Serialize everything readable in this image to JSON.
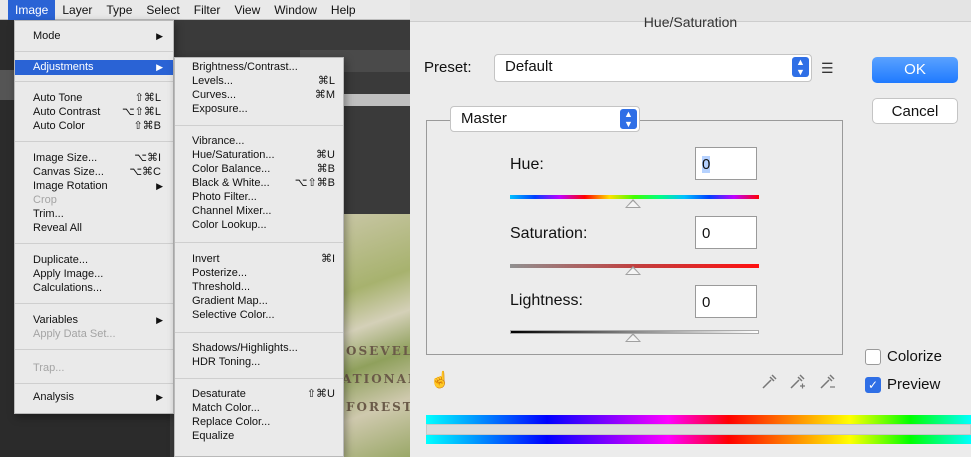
{
  "menubar": {
    "items": [
      "Image",
      "Layer",
      "Type",
      "Select",
      "Filter",
      "View",
      "Window",
      "Help"
    ],
    "active": "Image"
  },
  "image_menu": {
    "items": [
      {
        "label": "Mode",
        "submenu": true
      },
      {
        "label": "Adjustments",
        "submenu": true,
        "highlighted": true
      },
      {
        "label": "Auto Tone",
        "shortcut": "⇧⌘L"
      },
      {
        "label": "Auto Contrast",
        "shortcut": "⌥⇧⌘L"
      },
      {
        "label": "Auto Color",
        "shortcut": "⇧⌘B"
      },
      {
        "label": "Image Size...",
        "shortcut": "⌥⌘I"
      },
      {
        "label": "Canvas Size...",
        "shortcut": "⌥⌘C"
      },
      {
        "label": "Image Rotation",
        "submenu": true
      },
      {
        "label": "Crop",
        "disabled": true
      },
      {
        "label": "Trim..."
      },
      {
        "label": "Reveal All"
      },
      {
        "label": "Duplicate..."
      },
      {
        "label": "Apply Image..."
      },
      {
        "label": "Calculations..."
      },
      {
        "label": "Variables",
        "submenu": true
      },
      {
        "label": "Apply Data Set...",
        "disabled": true
      },
      {
        "label": "Trap...",
        "disabled": true
      },
      {
        "label": "Analysis",
        "submenu": true
      }
    ]
  },
  "adjustments_menu": {
    "items": [
      {
        "label": "Brightness/Contrast..."
      },
      {
        "label": "Levels...",
        "shortcut": "⌘L"
      },
      {
        "label": "Curves...",
        "shortcut": "⌘M"
      },
      {
        "label": "Exposure..."
      },
      {
        "label": "Vibrance..."
      },
      {
        "label": "Hue/Saturation...",
        "shortcut": "⌘U"
      },
      {
        "label": "Color Balance...",
        "shortcut": "⌘B"
      },
      {
        "label": "Black & White...",
        "shortcut": "⌥⇧⌘B"
      },
      {
        "label": "Photo Filter..."
      },
      {
        "label": "Channel Mixer..."
      },
      {
        "label": "Color Lookup..."
      },
      {
        "label": "Invert",
        "shortcut": "⌘I"
      },
      {
        "label": "Posterize..."
      },
      {
        "label": "Threshold..."
      },
      {
        "label": "Gradient Map..."
      },
      {
        "label": "Selective Color..."
      },
      {
        "label": "Shadows/Highlights..."
      },
      {
        "label": "HDR Toning..."
      },
      {
        "label": "Desaturate",
        "shortcut": "⇧⌘U"
      },
      {
        "label": "Match Color..."
      },
      {
        "label": "Replace Color..."
      },
      {
        "label": "Equalize"
      }
    ]
  },
  "map_text": [
    "OSEVELT",
    "ATIONAL",
    "FOREST"
  ],
  "dialog": {
    "title": "Hue/Saturation",
    "preset_label": "Preset:",
    "preset_value": "Default",
    "preset_options_icon": "list-options-icon",
    "ok_label": "OK",
    "cancel_label": "Cancel",
    "channel_value": "Master",
    "hue_label": "Hue:",
    "hue_value": "0",
    "saturation_label": "Saturation:",
    "saturation_value": "0",
    "lightness_label": "Lightness:",
    "lightness_value": "0",
    "colorize_label": "Colorize",
    "colorize_checked": false,
    "preview_label": "Preview",
    "preview_checked": true,
    "accent_color": "#2f6fe6"
  }
}
